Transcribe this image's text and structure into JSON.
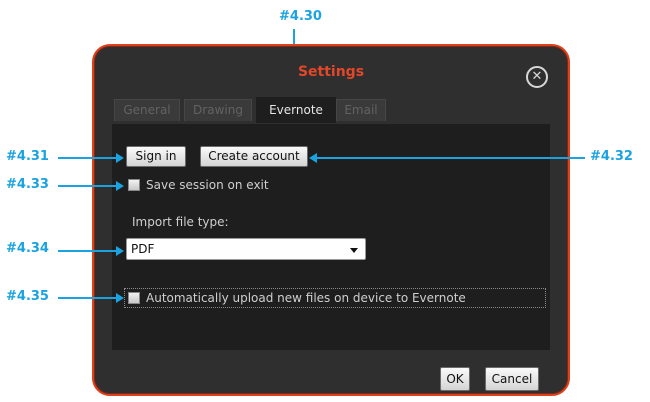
{
  "callouts": {
    "c430": "#4.30",
    "c431": "#4.31",
    "c432": "#4.32",
    "c433": "#4.33",
    "c434": "#4.34",
    "c435": "#4.35"
  },
  "dialog": {
    "title": "Settings",
    "close_icon": "✕",
    "tabs": [
      "General",
      "Drawing",
      "Evernote",
      "Email"
    ],
    "active_tab": "Evernote",
    "sign_in_label": "Sign in",
    "create_account_label": "Create account",
    "save_session_label": "Save session on exit",
    "save_session_checked": false,
    "import_label": "Import file type:",
    "import_value": "PDF",
    "auto_upload_label": "Automatically upload new files on device to Evernote",
    "auto_upload_checked": false,
    "ok_label": "OK",
    "cancel_label": "Cancel"
  },
  "colors": {
    "accent": "#1aa3e0",
    "dialog_border": "#e0401a",
    "title": "#e2472a"
  }
}
